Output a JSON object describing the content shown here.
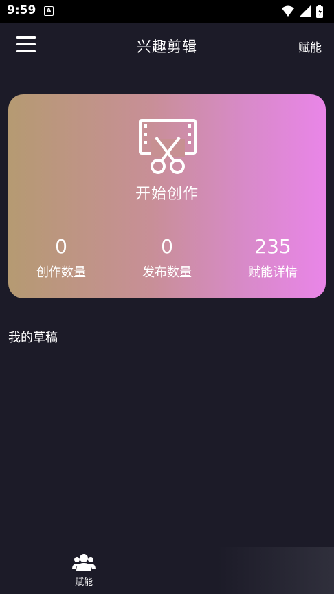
{
  "status_bar": {
    "time": "9:59",
    "notification_icon": "A"
  },
  "header": {
    "title": "兴趣剪辑",
    "right_action": "赋能",
    "menu_icon": "hamburger-menu-icon"
  },
  "card": {
    "icon": "film-scissors-icon",
    "cta_label": "开始创作",
    "stats": [
      {
        "value": "0",
        "label": "创作数量"
      },
      {
        "value": "0",
        "label": "发布数量"
      },
      {
        "value": "235",
        "label": "赋能详情"
      }
    ]
  },
  "drafts": {
    "heading": "我的草稿"
  },
  "bottom_nav": {
    "items": [
      {
        "label": "赋能",
        "icon": "users-icon"
      }
    ]
  },
  "colors": {
    "background": "#1c1b28",
    "card_gradient_start": "#b59a72",
    "card_gradient_end": "#e985e8"
  }
}
